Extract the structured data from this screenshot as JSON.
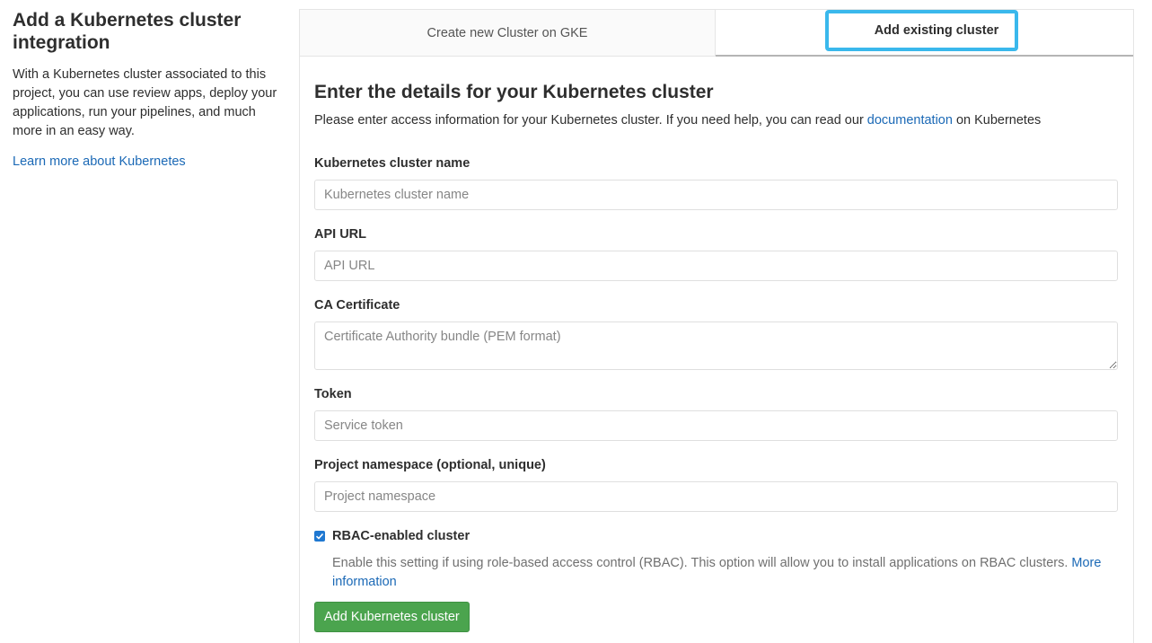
{
  "left": {
    "title": "Add a Kubernetes cluster integration",
    "description": "With a Kubernetes cluster associated to this project, you can use review apps, deploy your applications, run your pipelines, and much more in an easy way.",
    "link": "Learn more about Kubernetes"
  },
  "tabs": [
    {
      "label": "Create new Cluster on GKE",
      "active": false
    },
    {
      "label": "Add existing cluster",
      "active": true
    }
  ],
  "form": {
    "heading": "Enter the details for your Kubernetes cluster",
    "intro_before": "Please enter access information for your Kubernetes cluster. If you need help, you can read our ",
    "intro_link": "documentation",
    "intro_after": " on Kubernetes",
    "fields": [
      {
        "label": "Kubernetes cluster name",
        "placeholder": "Kubernetes cluster name"
      },
      {
        "label": "API URL",
        "placeholder": "API URL"
      },
      {
        "label": "CA Certificate",
        "placeholder": "Certificate Authority bundle (PEM format)"
      },
      {
        "label": "Token",
        "placeholder": "Service token"
      },
      {
        "label": "Project namespace (optional, unique)",
        "placeholder": "Project namespace"
      }
    ],
    "rbac": {
      "label": "RBAC-enabled cluster",
      "checked": true,
      "help": "Enable this setting if using role-based access control (RBAC). This option will allow you to install applications on RBAC clusters. ",
      "help_link": "More information"
    },
    "submit_label": "Add Kubernetes cluster"
  },
  "colors": {
    "link": "#1b69b6",
    "submit": "#4ba44e",
    "checkbox": "#1f78d1",
    "tab_highlight": "#3ab8ec"
  }
}
